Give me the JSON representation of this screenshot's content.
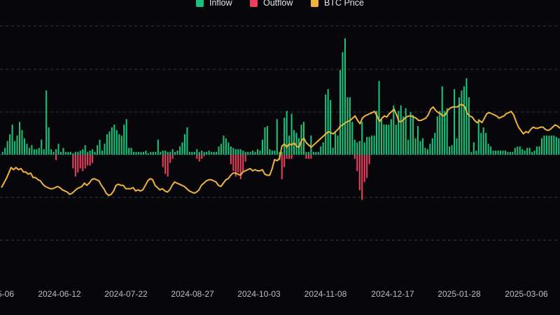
{
  "chart_data": {
    "type": "bar",
    "title": "",
    "xlabel": "",
    "ylabel": "",
    "grid": true,
    "legend_position": "top-center",
    "x_tick_labels": [
      "5-06",
      "2024-06-12",
      "2024-07-22",
      "2024-08-27",
      "2024-10-03",
      "2024-11-08",
      "2024-12-17",
      "2025-01-28",
      "2025-03-06"
    ],
    "flow_ylim": [
      -100,
      105
    ],
    "price_ylim": [
      0,
      100
    ],
    "series": [
      {
        "name": "Inflow",
        "color": "#18c27a",
        "values": [
          2,
          5,
          10,
          15,
          22,
          10,
          14,
          24,
          18,
          12,
          8,
          5,
          7,
          4,
          4,
          5,
          11,
          4,
          47,
          20,
          4,
          2,
          4,
          8,
          2,
          5,
          2,
          2,
          2,
          1,
          2,
          2,
          3,
          4,
          7,
          2,
          3,
          4,
          2,
          7,
          11,
          3,
          8,
          15,
          17,
          20,
          22,
          18,
          15,
          14,
          22,
          26,
          5,
          5,
          2,
          2,
          2,
          2,
          2,
          3,
          1,
          2,
          2,
          2,
          11,
          2,
          3,
          3,
          2,
          2,
          4,
          2,
          3,
          6,
          9,
          15,
          20,
          2,
          2,
          2,
          4,
          2,
          3,
          2,
          2,
          3,
          2,
          2,
          2,
          6,
          8,
          14,
          12,
          9,
          6,
          5,
          4,
          4,
          4,
          3,
          2,
          2,
          2,
          3,
          2,
          4,
          3,
          11,
          20,
          21,
          4,
          3,
          3,
          26,
          2,
          2,
          27,
          32,
          14,
          30,
          18,
          16,
          12,
          22,
          24,
          2,
          2,
          14,
          2,
          2,
          2,
          6,
          9,
          44,
          48,
          40,
          5,
          16,
          14,
          62,
          75,
          85,
          42,
          42,
          24,
          11,
          9,
          10,
          24,
          9,
          13,
          13,
          14,
          14,
          32,
          54,
          26,
          22,
          22,
          22,
          26,
          36,
          22,
          32,
          36,
          28,
          34,
          11,
          31,
          29,
          12,
          21,
          10,
          12,
          5,
          4,
          8,
          12,
          16,
          28,
          32,
          50,
          32,
          34,
          6,
          7,
          48,
          12,
          42,
          47,
          50,
          56,
          42,
          2,
          9,
          3,
          26,
          16,
          20,
          16,
          8,
          6,
          3,
          3,
          3,
          3,
          3,
          3,
          2,
          2,
          2,
          5,
          6,
          6,
          4,
          3,
          5,
          5,
          2,
          3,
          6,
          6,
          12,
          14,
          14,
          14,
          14,
          14,
          13,
          12
        ]
      },
      {
        "name": "Outflow",
        "color": "#ea3f5c",
        "values": [
          0,
          0,
          0,
          0,
          0,
          0,
          0,
          0,
          0,
          0,
          0,
          0,
          0,
          0,
          0,
          0,
          0,
          0,
          0,
          0,
          0,
          0,
          4,
          0,
          0,
          0,
          0,
          0,
          0,
          10,
          16,
          13,
          10,
          12,
          10,
          8,
          8,
          6,
          0,
          0,
          0,
          0,
          0,
          0,
          0,
          0,
          0,
          0,
          0,
          0,
          0,
          0,
          0,
          0,
          0,
          0,
          0,
          0,
          0,
          0,
          0,
          0,
          0,
          0,
          0,
          0,
          9,
          14,
          16,
          6,
          3,
          0,
          0,
          0,
          0,
          0,
          0,
          0,
          0,
          0,
          3,
          5,
          3,
          1,
          0,
          0,
          0,
          0,
          0,
          0,
          0,
          0,
          0,
          0,
          7,
          12,
          16,
          13,
          18,
          12,
          5,
          0,
          0,
          0,
          0,
          0,
          0,
          0,
          0,
          0,
          0,
          0,
          0,
          0,
          4,
          18,
          9,
          3,
          3,
          3,
          0,
          0,
          0,
          0,
          0,
          3,
          3,
          3,
          0,
          0,
          0,
          0,
          0,
          0,
          0,
          0,
          0,
          0,
          0,
          0,
          0,
          0,
          0,
          0,
          0,
          3,
          12,
          26,
          33,
          20,
          17,
          7,
          0,
          0,
          0,
          0,
          0,
          0,
          0,
          0,
          0,
          0,
          0,
          0,
          0,
          0,
          0,
          0,
          0,
          0,
          0,
          0,
          0,
          0,
          0,
          0,
          0,
          0,
          0,
          0,
          0,
          0,
          0,
          0,
          0,
          0,
          0,
          0,
          0,
          0,
          0,
          0,
          0,
          0,
          0,
          0,
          0,
          0,
          0,
          0,
          0,
          0,
          0,
          0,
          0,
          0,
          0,
          0,
          0,
          0,
          0,
          0,
          0,
          0,
          0,
          0,
          0,
          0,
          0,
          0,
          0,
          0,
          0,
          0,
          0,
          0,
          0,
          0,
          0,
          0,
          0,
          0,
          0,
          0,
          0,
          0,
          0,
          0,
          0,
          0,
          0,
          0,
          0,
          0,
          0,
          0,
          0,
          0,
          0,
          0,
          0,
          0,
          0,
          0,
          0,
          0,
          0,
          0,
          0,
          0,
          0,
          0,
          0,
          0,
          0,
          0,
          0,
          0,
          0,
          0,
          0,
          0,
          0,
          0
        ]
      },
      {
        "name": "BTC Price",
        "color": "#f0b43a",
        "type": "line",
        "values": [
          20,
          24,
          28,
          33,
          38,
          36,
          38,
          36,
          37,
          34,
          34,
          32,
          33,
          29,
          29,
          27,
          26,
          23,
          21,
          20,
          19,
          19,
          20,
          21,
          20,
          18,
          17,
          16,
          14,
          15,
          17,
          19,
          20,
          21,
          24,
          22,
          24,
          27,
          28,
          27,
          26,
          22,
          19,
          15,
          13,
          14,
          17,
          22,
          23,
          22,
          22,
          19,
          19,
          19,
          20,
          17,
          18,
          17,
          18,
          22,
          26,
          28,
          27,
          22,
          20,
          18,
          19,
          17,
          16,
          18,
          22,
          25,
          24,
          23,
          22,
          21,
          19,
          17,
          16,
          15,
          16,
          18,
          22,
          24,
          26,
          27,
          27,
          26,
          25,
          22,
          21,
          24,
          27,
          28,
          31,
          33,
          33,
          32,
          31,
          34,
          35,
          36,
          37,
          35,
          36,
          35,
          35,
          36,
          32,
          31,
          31,
          37,
          45,
          44,
          46,
          57,
          59,
          56,
          59,
          58,
          60,
          57,
          56,
          62,
          64,
          60,
          58,
          56,
          58,
          60,
          62,
          64,
          66,
          68,
          70,
          69,
          68,
          70,
          72,
          75,
          76,
          78,
          79,
          80,
          82,
          84,
          80,
          77,
          82,
          84,
          85,
          86,
          87,
          88,
          84,
          79,
          82,
          84,
          83,
          86,
          88,
          90,
          85,
          79,
          79,
          81,
          83,
          84,
          84,
          83,
          82,
          80,
          80,
          81,
          82,
          85,
          90,
          92,
          89,
          87,
          86,
          84,
          85,
          89,
          91,
          92,
          92,
          92,
          94,
          94,
          92,
          86,
          84,
          83,
          80,
          78,
          80,
          78,
          82,
          86,
          87,
          86,
          85,
          84,
          82,
          83,
          84,
          86,
          87,
          88,
          85,
          79,
          74,
          71,
          68,
          70,
          69,
          72,
          74,
          73,
          73,
          74,
          74,
          72,
          71,
          72,
          74,
          76,
          75,
          73
        ]
      }
    ]
  }
}
